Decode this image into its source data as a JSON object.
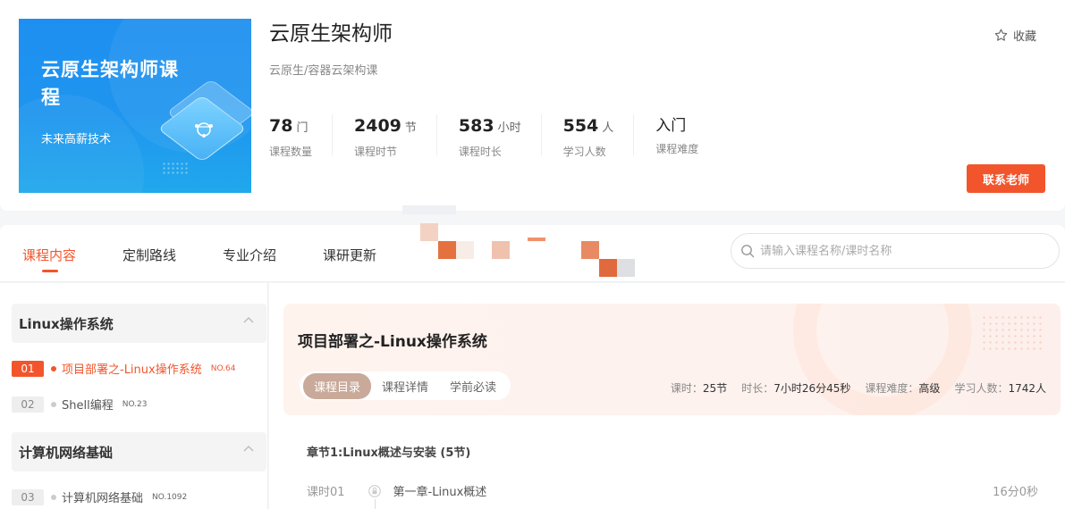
{
  "course": {
    "cover_title": "云原生架构师课程",
    "cover_subtitle": "未来高薪技术",
    "title": "云原生架构师",
    "category": "云原生/容器云架构课",
    "favorite_label": "收藏",
    "contact_label": "联系老师",
    "stats": [
      {
        "num": "78",
        "unit": "门",
        "label": "课程数量"
      },
      {
        "num": "2409",
        "unit": "节",
        "label": "课程时节"
      },
      {
        "num": "583",
        "unit": "小时",
        "label": "课程时长"
      },
      {
        "num": "554",
        "unit": "人",
        "label": "学习人数"
      },
      {
        "num": "入门",
        "unit": "",
        "label": "课程难度"
      }
    ]
  },
  "tabs": [
    "课程内容",
    "定制路线",
    "专业介绍",
    "课研更新"
  ],
  "search": {
    "placeholder": "请输入课程名称/课时名称"
  },
  "sidebar": {
    "chapters": [
      {
        "title": "Linux操作系统"
      },
      {
        "title": "计算机网络基础"
      }
    ],
    "lessons": [
      {
        "idx": "01",
        "name": "项目部署之-Linux操作系统",
        "no": "NO.64"
      },
      {
        "idx": "02",
        "name": "Shell编程",
        "no": "NO.23"
      },
      {
        "idx": "03",
        "name": "计算机网络基础",
        "no": "NO.1092"
      }
    ]
  },
  "detail": {
    "title": "项目部署之-Linux操作系统",
    "subtabs": [
      "课程目录",
      "课程详情",
      "学前必读"
    ],
    "meta": [
      {
        "label": "课时：",
        "value": "25节"
      },
      {
        "label": "时长：",
        "value": "7小时26分45秒"
      },
      {
        "label": "课程难度：",
        "value": "高级"
      },
      {
        "label": "学习人数：",
        "value": "1742人"
      }
    ],
    "section_title": "章节1:Linux概述与安装 (5节)",
    "lesson_row": {
      "index": "课时01",
      "name": "第一章-Linux概述",
      "duration": "16分0秒"
    }
  },
  "colors": {
    "accent": "#f2552c",
    "cover_blue": "#1f95ef",
    "subtab_active": "#c9a99a"
  }
}
